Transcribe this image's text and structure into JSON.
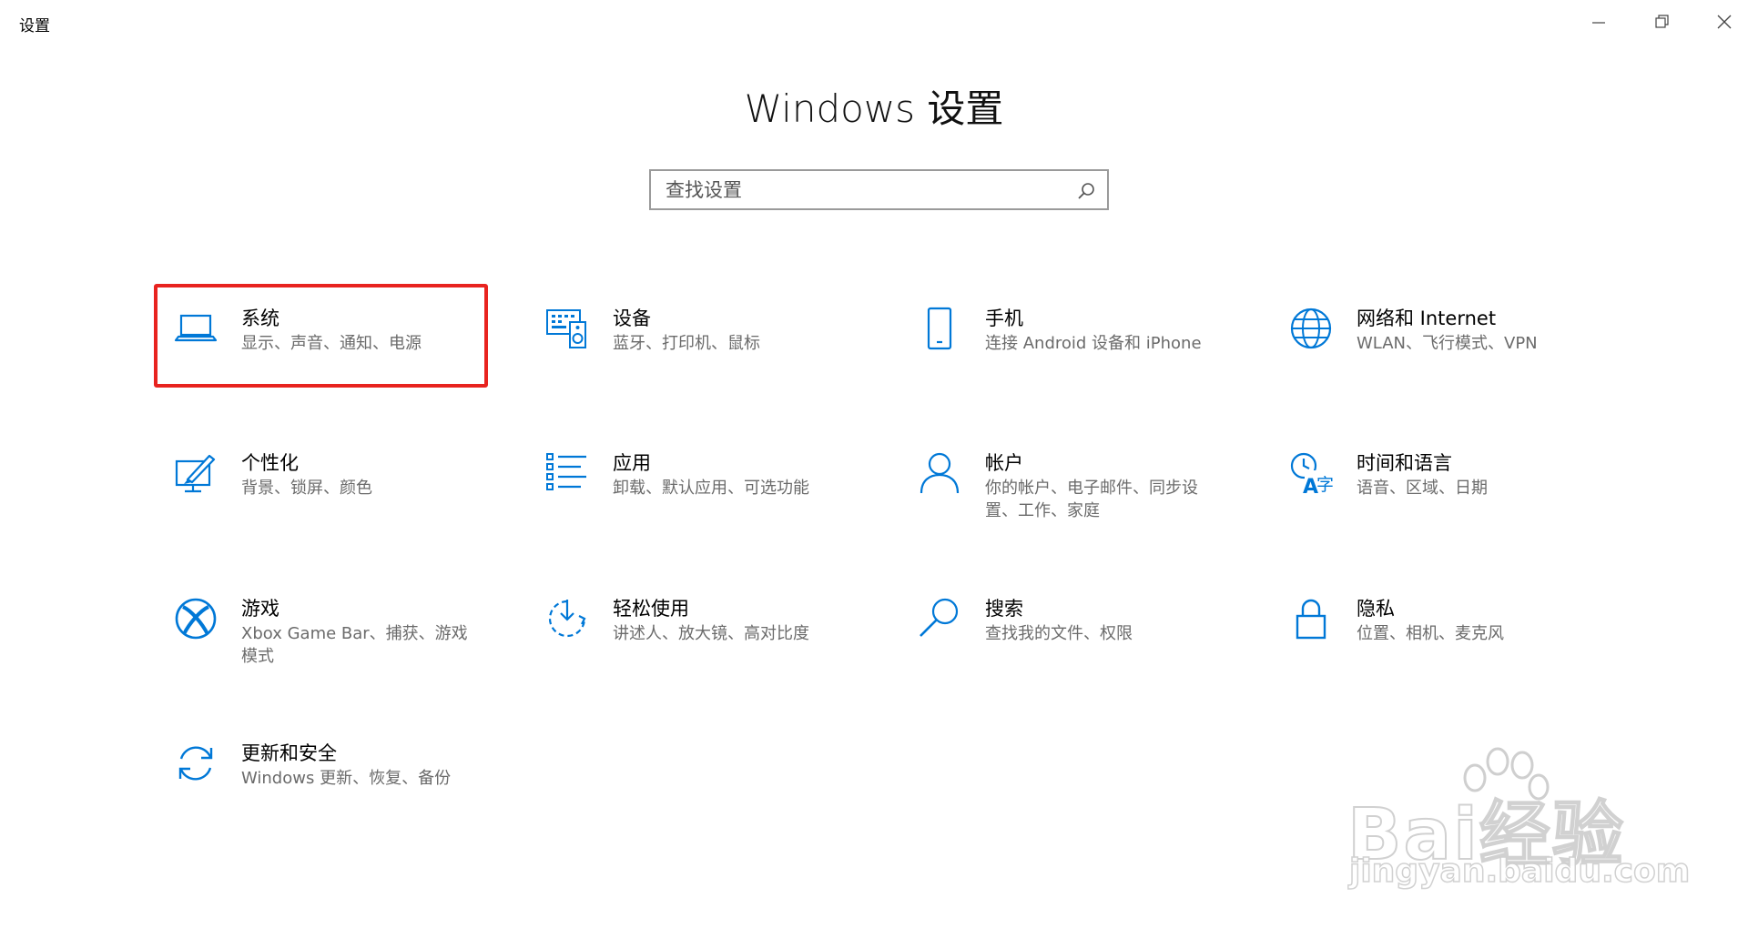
{
  "window": {
    "title": "设置",
    "controls": [
      "minimize-icon",
      "restore-icon",
      "close-icon"
    ]
  },
  "page": {
    "title": "Windows 设置"
  },
  "search": {
    "placeholder": "查找设置",
    "value": "",
    "icon": "search-icon"
  },
  "colors": {
    "accent": "#0078d7",
    "highlight": "#e8231f",
    "desc": "#6b6b6b"
  },
  "tiles": [
    {
      "title": "系统",
      "desc": "显示、声音、通知、电源",
      "icon": "laptop-icon",
      "highlighted": true
    },
    {
      "title": "设备",
      "desc": "蓝牙、打印机、鼠标",
      "icon": "keyboard-speaker-icon"
    },
    {
      "title": "手机",
      "desc": "连接 Android 设备和 iPhone",
      "icon": "phone-icon"
    },
    {
      "title": "网络和 Internet",
      "desc": "WLAN、飞行模式、VPN",
      "icon": "globe-icon"
    },
    {
      "title": "个性化",
      "desc": "背景、锁屏、颜色",
      "icon": "paint-icon"
    },
    {
      "title": "应用",
      "desc": "卸载、默认应用、可选功能",
      "icon": "app-list-icon"
    },
    {
      "title": "帐户",
      "desc": "你的帐户、电子邮件、同步设置、工作、家庭",
      "icon": "person-icon"
    },
    {
      "title": "时间和语言",
      "desc": "语音、区域、日期",
      "icon": "time-language-icon"
    },
    {
      "title": "游戏",
      "desc": "Xbox Game Bar、捕获、游戏模式",
      "icon": "xbox-icon"
    },
    {
      "title": "轻松使用",
      "desc": "讲述人、放大镜、高对比度",
      "icon": "ease-of-access-icon"
    },
    {
      "title": "搜索",
      "desc": "查找我的文件、权限",
      "icon": "search-icon"
    },
    {
      "title": "隐私",
      "desc": "位置、相机、麦克风",
      "icon": "lock-icon"
    },
    {
      "title": "更新和安全",
      "desc": "Windows 更新、恢复、备份",
      "icon": "sync-icon"
    }
  ],
  "watermark": {
    "brand": "Bai经验",
    "url": "jingyan.baidu.com"
  }
}
